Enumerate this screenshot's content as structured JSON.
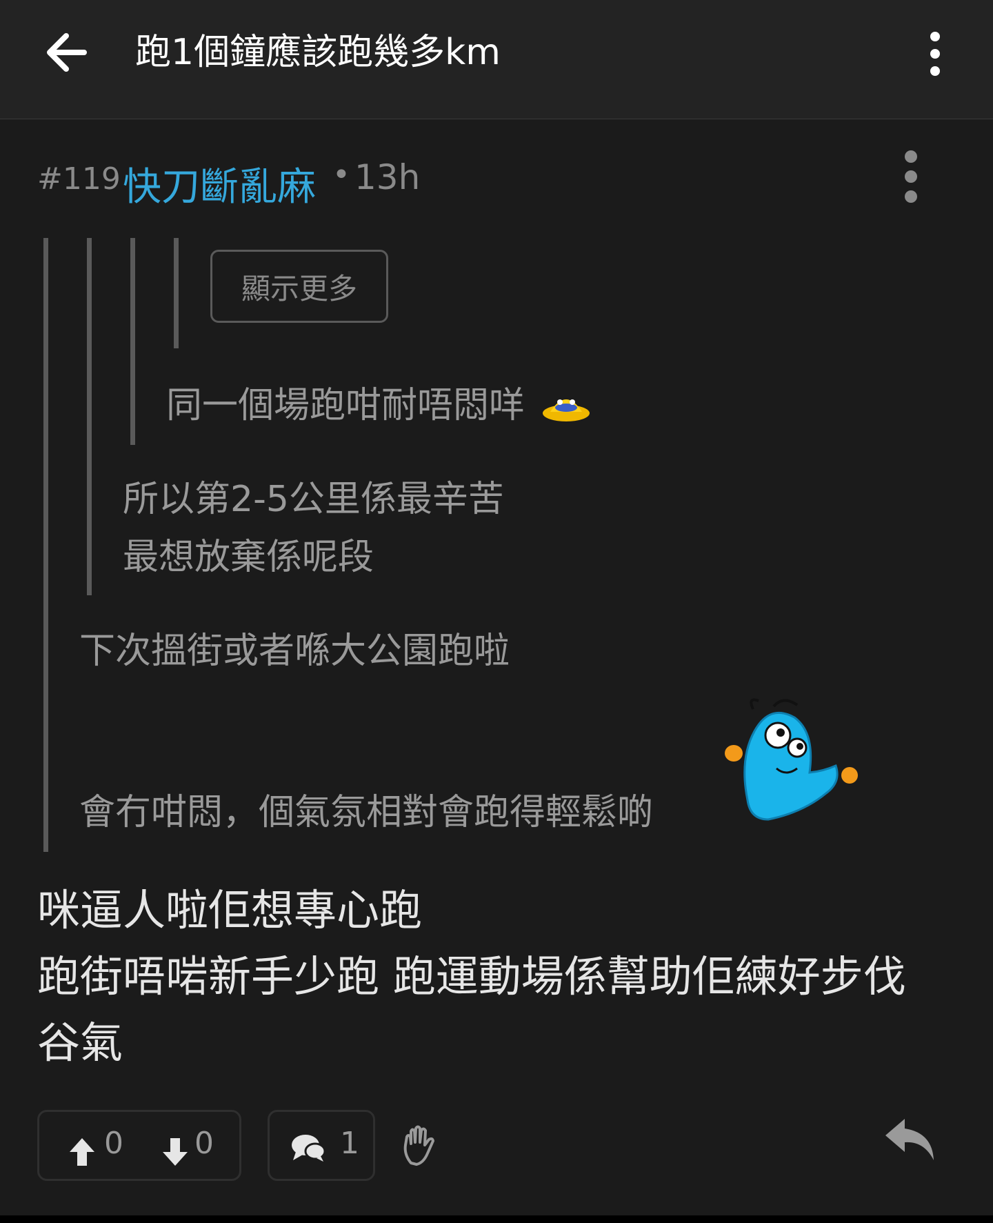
{
  "header": {
    "title": "跑1個鐘應該跑幾多km"
  },
  "post": {
    "number": "#119",
    "author": "快刀斷亂麻",
    "separator": "•",
    "time": "13h",
    "show_more_label": "顯示更多",
    "quote_level3": "同一個場跑咁耐唔悶咩",
    "quote_level2": [
      "所以第2-5公里係最辛苦",
      "最想放棄係呢段"
    ],
    "quote_level1": [
      "下次搵街或者喺大公園跑啦",
      "會冇咁悶，個氣氛相對會跑得輕鬆啲"
    ],
    "body": [
      "咪逼人啦佢想專心跑",
      "跑街唔啱新手少跑 跑運動場係幫助佢練好步伐",
      "谷氣"
    ]
  },
  "actions": {
    "upvotes": "0",
    "downvotes": "0",
    "comments": "1"
  },
  "colors": {
    "background": "#1b1b1b",
    "author": "#35a8dc",
    "muted": "#8a8a8a"
  }
}
